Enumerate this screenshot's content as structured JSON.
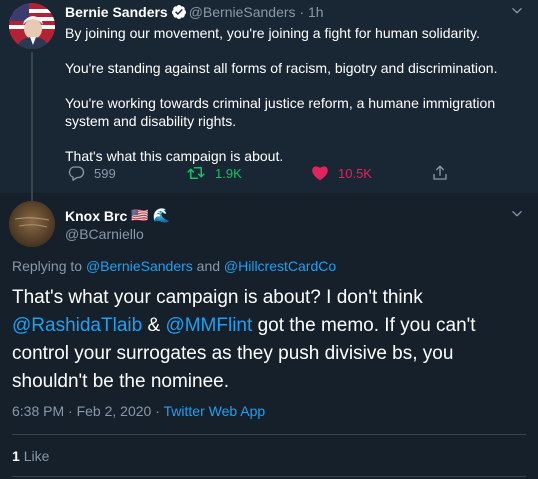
{
  "parent": {
    "name": "Bernie Sanders",
    "handle": "@BernieSanders",
    "sep": "·",
    "time": "1h",
    "paragraphs": [
      "By joining our movement, you're joining a fight for human solidarity.",
      "You're standing against all forms of racism, bigotry and discrimination.",
      "You're working towards criminal justice reform, a humane immigration system and disability rights.",
      "That's what this campaign is about."
    ],
    "replies": "599",
    "retweets": "1.9K",
    "likes": "10.5K",
    "icons": {
      "reply": "reply-icon",
      "retweet": "retweet-icon",
      "like": "heart-icon",
      "share": "share-icon",
      "verified": "verified-badge-icon",
      "menu": "chevron-down-icon"
    }
  },
  "reply": {
    "name": "Knox Brc",
    "handle": "@BCarniello",
    "name_emojis": [
      "🇺🇸",
      "🌊"
    ],
    "replying_prefix": "Replying to",
    "replying_to_1": "@BernieSanders",
    "replying_and": "and",
    "replying_to_2": "@HillcrestCardCo",
    "text_1": "That's what your campaign is about? I don't think",
    "mention_1": "@RashidaTlaib",
    "text_amp": "&",
    "mention_2": "@MMFlint",
    "text_2": "got the memo. If you can't control your surrogates as they push divisive bs, you shouldn't be the nominee.",
    "time": "6:38 PM",
    "date": "Feb 2, 2020",
    "sep": "·",
    "source": "Twitter Web App",
    "like_count": "1",
    "like_label": "Like"
  },
  "colors": {
    "background": "#15202b",
    "parent_background": "#192734",
    "accent": "#1da1f2",
    "muted": "#8899a6",
    "retweet": "#17bf63",
    "like": "#e0245e"
  }
}
